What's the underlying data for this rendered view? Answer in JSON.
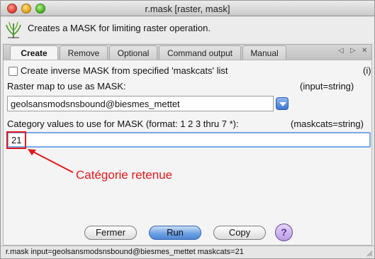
{
  "window": {
    "title": "r.mask [raster, mask]"
  },
  "header": {
    "description": "Creates a MASK for limiting raster operation.",
    "logo_icon": "grass-logo-icon"
  },
  "tabs": [
    {
      "label": "Create",
      "active": true
    },
    {
      "label": "Remove",
      "active": false
    },
    {
      "label": "Optional",
      "active": false
    },
    {
      "label": "Command output",
      "active": false
    },
    {
      "label": "Manual",
      "active": false
    }
  ],
  "tab_nav": {
    "prev": "◁",
    "next": "▷",
    "close": "✕"
  },
  "panel": {
    "inverse_checkbox": {
      "label": "Create inverse MASK from specified 'maskcats' list",
      "checked": false,
      "flag": "(i)"
    },
    "raster": {
      "label": "Raster map to use as MASK:",
      "param": "(input=string)",
      "value": "geolsansmodsnsbound@biesmes_mettet"
    },
    "maskcats": {
      "label": "Category values to use for MASK (format: 1 2 3 thru 7 *):",
      "param": "(maskcats=string)",
      "value": "21"
    }
  },
  "annotation": {
    "text": "Catégorie retenue",
    "color": "#e0191b"
  },
  "buttons": {
    "close": "Fermer",
    "run": "Run",
    "copy": "Copy",
    "help": "?"
  },
  "statusbar": {
    "command": "r.mask input=geolsansmodsnsbound@biesmes_mettet maskcats=21"
  }
}
